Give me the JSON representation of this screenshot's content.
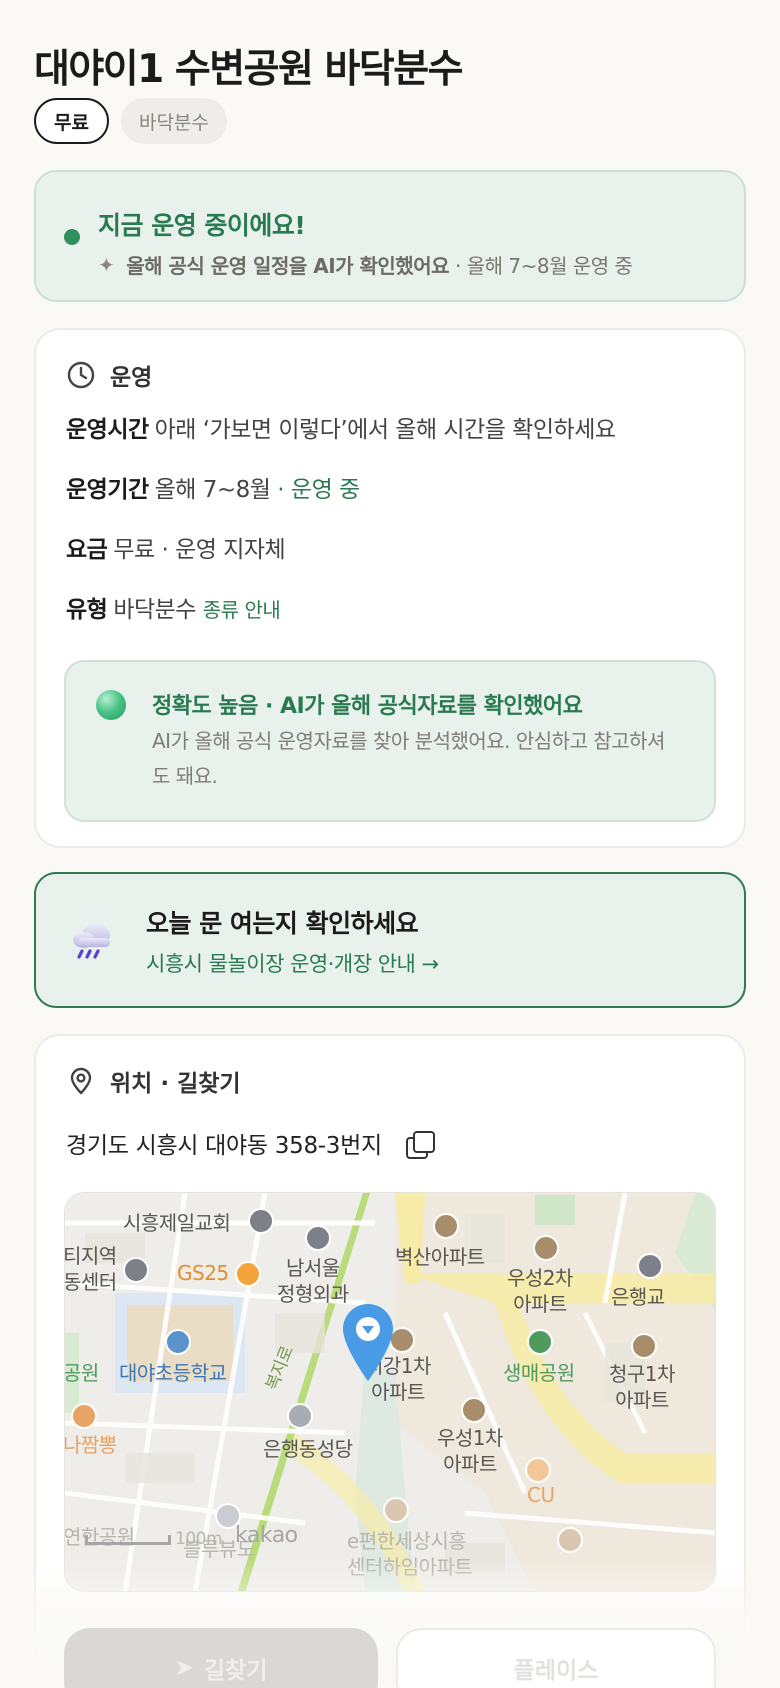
{
  "title": "대야이1 수변공원 바닥분수",
  "chips": {
    "price": "무료",
    "category": "바닥분수"
  },
  "status": {
    "headline": "지금 운영 중이에요!",
    "ai_note": "올해 공식 운영 일정을 AI가 확인했어요",
    "period_note": "· 올해 7~8월 운영 중",
    "color": "#2f8f5e"
  },
  "operation": {
    "header": "운영",
    "hours_label": "운영시간",
    "hours_value": "아래 ‘가보면 이렇다’에서 올해 시간을 확인하세요",
    "period_label": "운영기간",
    "period_value": "올해 7~8월",
    "period_status": "· 운영 중",
    "fee_label": "요금",
    "fee_value": "무료 · 운영 지자체",
    "type_label": "유형",
    "type_value": "바닥분수",
    "type_link": "종류 안내",
    "accuracy_title": "정확도 높음 · AI가 올해 공식자료를 확인했어요",
    "accuracy_desc": "AI가 올해 공식 운영자료를 찾아 분석했어요. 안심하고 참고하셔도 돼요."
  },
  "notice": {
    "title": "오늘 문 여는지 확인하세요",
    "link": "시흥시 물놀이장 운영·개장 안내 →",
    "icon": "rain-cloud-icon"
  },
  "location": {
    "header": "위치 · 길찾기",
    "address": "경기도 시흥시 대야동 358-3번지",
    "map": {
      "labels": {
        "church": "시흥제일교회",
        "station": "티지역\n동센터",
        "gs25": "GS25",
        "clinic": "남서울\n정형외과",
        "apt_byeoksan": "벽산아파트",
        "apt_woosung2": "우성2차\n아파트",
        "bank": "은행교",
        "park_left": "공원",
        "school": "대야초등학교",
        "road": "복지로",
        "apt_seogang": "서강1차\n아파트",
        "park_saengmae": "생매공원",
        "apt_cheonggu": "청구1차\n아파트",
        "restaurant": "나짬뽕",
        "cathedral": "은행동성당",
        "apt_woosung1": "우성1차\n아파트",
        "cu": "CU",
        "park_bottom": "연한공원",
        "scale": "100m",
        "kakao": "kakao",
        "apt_bottom1": "e편한세상시흥",
        "apt_bottom2": "센터하임아파트",
        "bottom_left": "블루뷰도"
      }
    }
  },
  "buttons": {
    "directions": "길찾기",
    "place": "플레이스"
  }
}
